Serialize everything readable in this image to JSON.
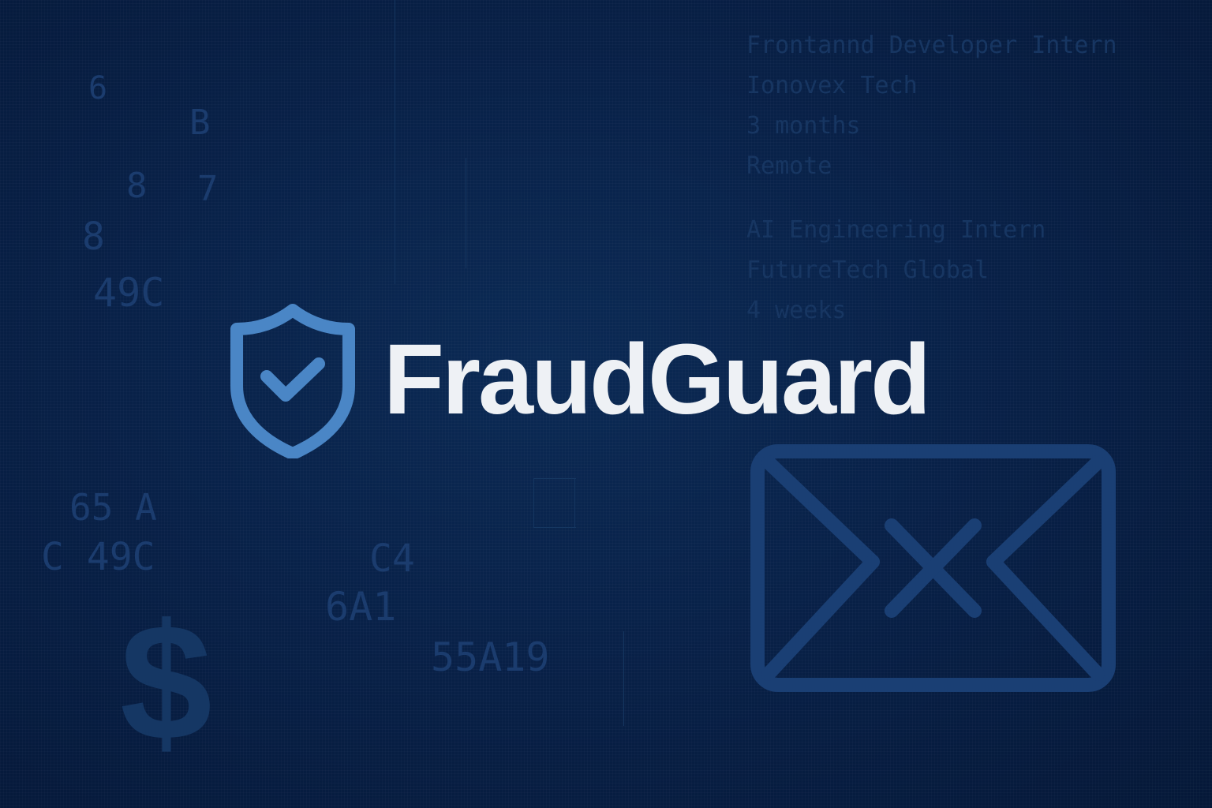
{
  "brand": {
    "name": "FraudGuard",
    "shield_icon": "shield-check-icon",
    "accent_color": "#4a86c6",
    "text_color": "#eef1f5"
  },
  "background": {
    "color": "#082148",
    "listings": [
      {
        "title": "Frontannd Developer Intern",
        "company": "Ionovex Tech",
        "duration": "3 months",
        "location": "Remote"
      },
      {
        "title": "AI Engineering Intern",
        "company": "FutureTech Global",
        "duration": "4 weeks"
      }
    ],
    "codes": [
      "6",
      "8",
      "7",
      "8",
      "49C",
      "65 A",
      "C 49C",
      "C4",
      "6A1",
      "55A19",
      "B"
    ],
    "icons": [
      "dollar-sign-icon",
      "envelope-icon"
    ],
    "dollar_glyph": "$"
  }
}
